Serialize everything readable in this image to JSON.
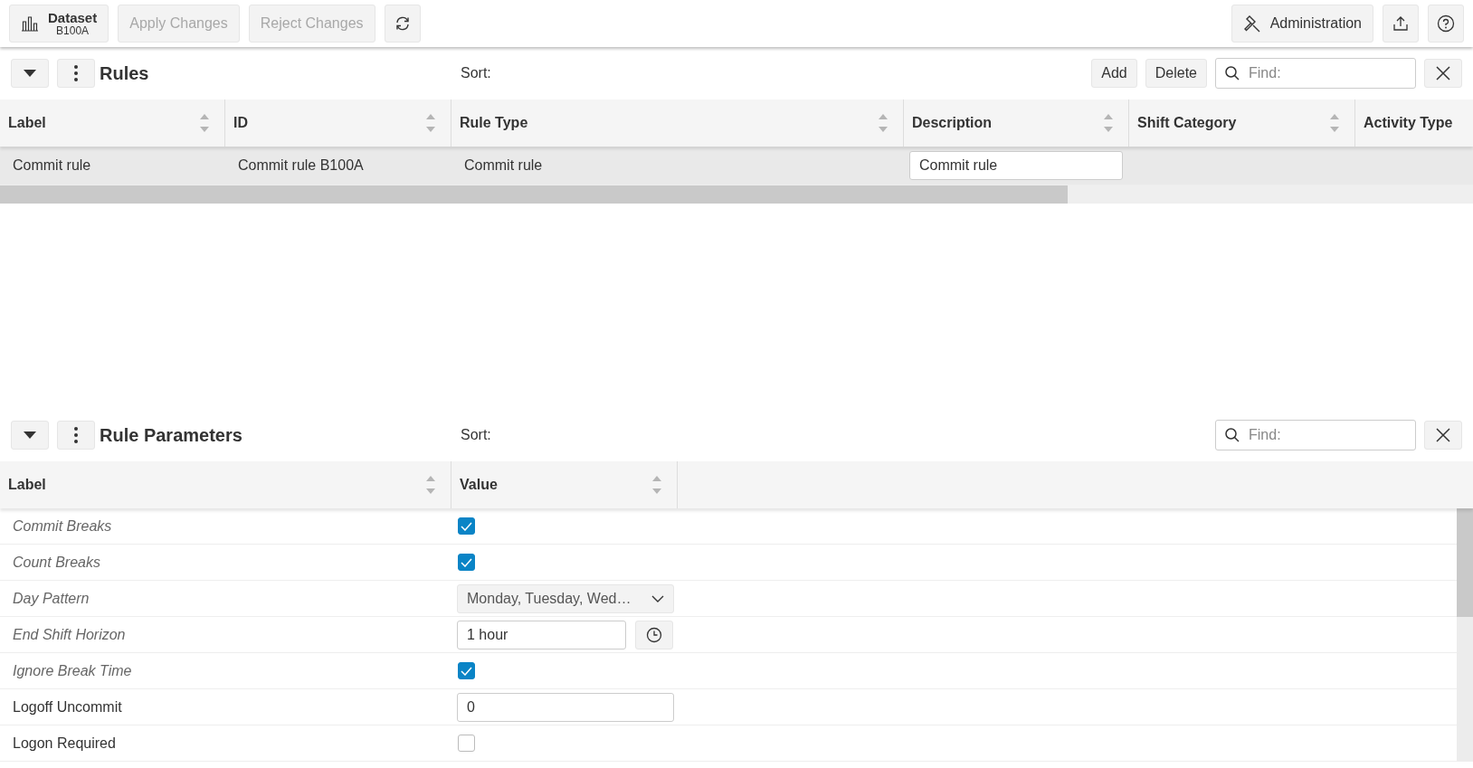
{
  "toolbar": {
    "dataset": {
      "label": "Dataset",
      "value": "B100A"
    },
    "buttons": [
      {
        "label": "Apply Changes",
        "disabled": true
      },
      {
        "label": "Reject Changes",
        "disabled": true
      }
    ],
    "administration": "Administration"
  },
  "rules": {
    "title": "Rules",
    "sort_label": "Sort:",
    "actions": [
      "Add",
      "Delete"
    ],
    "search": {
      "placeholder": "Find:"
    },
    "columns": [
      "Label",
      "ID",
      "Rule Type",
      "Description",
      "Shift Category",
      "Activity Type"
    ],
    "rows": [
      {
        "selected": true,
        "cells": [
          "Commit rule",
          "Commit rule B100A",
          "Commit rule",
          "Commit rule",
          "",
          ""
        ]
      }
    ]
  },
  "rule_parameters": {
    "title": "Rule Parameters",
    "sort_label": "Sort:",
    "search": {
      "placeholder": "Find:"
    },
    "columns": [
      "Label",
      "Value"
    ],
    "rows": [
      {
        "label": "Commit Breaks",
        "inherited": true,
        "kind": "checkbox",
        "checked": true
      },
      {
        "label": "Count Breaks",
        "inherited": true,
        "kind": "checkbox",
        "checked": true
      },
      {
        "label": "Day Pattern",
        "inherited": true,
        "kind": "dropdown",
        "value": "Monday, Tuesday, Wed…"
      },
      {
        "label": "End Shift Horizon",
        "inherited": true,
        "kind": "duration",
        "value": "1 hour"
      },
      {
        "label": "Ignore Break Time",
        "inherited": true,
        "kind": "checkbox",
        "checked": true
      },
      {
        "label": "Logoff Uncommit",
        "inherited": false,
        "kind": "number",
        "value": "0"
      },
      {
        "label": "Logon Required",
        "inherited": false,
        "kind": "checkbox",
        "checked": false
      }
    ]
  }
}
